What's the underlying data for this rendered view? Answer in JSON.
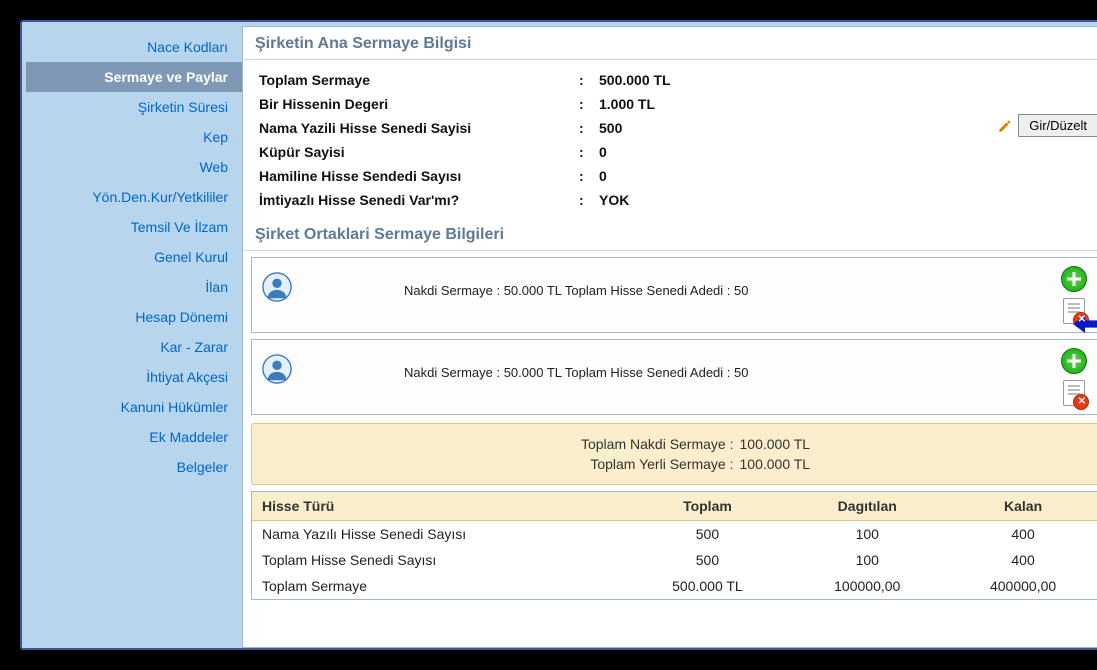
{
  "sidebar": {
    "items": [
      {
        "label": "Nace Kodları",
        "active": false
      },
      {
        "label": "Sermaye ve Paylar",
        "active": true
      },
      {
        "label": "Şirketin Süresi",
        "active": false
      },
      {
        "label": "Kep",
        "active": false
      },
      {
        "label": "Web",
        "active": false
      },
      {
        "label": "Yön.Den.Kur/Yetkililer",
        "active": false
      },
      {
        "label": "Temsil Ve İlzam",
        "active": false
      },
      {
        "label": "Genel Kurul",
        "active": false
      },
      {
        "label": "İlan",
        "active": false
      },
      {
        "label": "Hesap Dönemi",
        "active": false
      },
      {
        "label": "Kar - Zarar",
        "active": false
      },
      {
        "label": "İhtiyat Akçesi",
        "active": false
      },
      {
        "label": "Kanuni Hükümler",
        "active": false
      },
      {
        "label": "Ek Maddeler",
        "active": false
      },
      {
        "label": "Belgeler",
        "active": false
      }
    ]
  },
  "anaSermaye": {
    "title": "Şirketin Ana Sermaye Bilgisi",
    "rows": [
      {
        "label": "Toplam Sermaye",
        "value": "500.000 TL"
      },
      {
        "label": "Bir Hissenin Degeri",
        "value": "1.000 TL"
      },
      {
        "label": "Nama Yazili Hisse Senedi Sayisi",
        "value": "500"
      },
      {
        "label": "Küpür Sayisi",
        "value": "0"
      },
      {
        "label": "Hamiline Hisse Sendedi Sayısı",
        "value": "0"
      },
      {
        "label": "İmtiyazlı Hisse Senedi Var'mı?",
        "value": "YOK"
      }
    ],
    "edit_label": "Gir/Düzelt"
  },
  "ortaklar": {
    "title": "Şirket Ortaklari Sermaye Bilgileri",
    "partners": [
      {
        "line": "Nakdi Sermaye : 50.000 TL Toplam Hisse Senedi Adedi : 50"
      },
      {
        "line": "Nakdi Sermaye : 50.000 TL Toplam Hisse Senedi Adedi : 50"
      }
    ]
  },
  "summary": {
    "rows": [
      {
        "label": "Toplam Nakdi Sermaye  :",
        "value": "100.000 TL"
      },
      {
        "label": "Toplam Yerli Sermaye  :",
        "value": "100.000 TL"
      }
    ]
  },
  "table": {
    "headers": [
      "Hisse Türü",
      "Toplam",
      "Dagıtılan",
      "Kalan"
    ],
    "rows": [
      [
        "Nama Yazılı Hisse Senedi Sayısı",
        "500",
        "100",
        "400"
      ],
      [
        "Toplam Hisse Senedi Sayısı",
        "500",
        "100",
        "400"
      ],
      [
        "Toplam Sermaye",
        "500.000 TL",
        "100000,00",
        "400000,00"
      ]
    ]
  }
}
